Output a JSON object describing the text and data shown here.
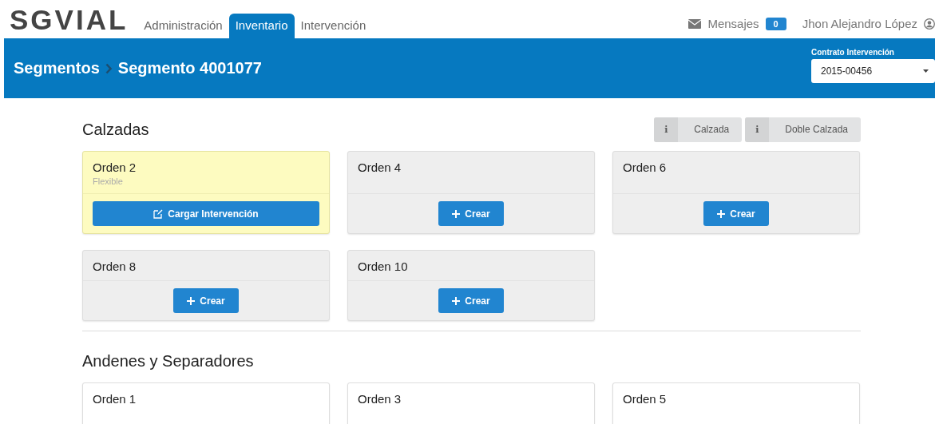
{
  "header": {
    "logo": "SGVIAL",
    "tabs": [
      {
        "label": "Administración",
        "selected": false
      },
      {
        "label": "Inventario",
        "selected": true
      },
      {
        "label": "Intervención",
        "selected": false
      }
    ],
    "messages": {
      "label": "Mensajes",
      "count": "0"
    },
    "user": "Jhon Alejandro López"
  },
  "title_bar": {
    "breadcrumb": [
      "Segmentos",
      "Segmento 4001077"
    ],
    "contract": {
      "label": "Contrato Intervención",
      "value": "2015-00456"
    }
  },
  "sections": [
    {
      "title": "Calzadas",
      "actions": [
        {
          "icon": "i",
          "label": "Calzada"
        },
        {
          "icon": "i",
          "label": "Doble Calzada"
        }
      ],
      "cards": [
        {
          "title": "Orden 2",
          "subtitle": "Flexible",
          "highlighted": true,
          "button": {
            "kind": "load",
            "label": "Cargar Intervención"
          }
        },
        {
          "title": "Orden 4",
          "highlighted": false,
          "button": {
            "kind": "create",
            "label": "Crear"
          }
        },
        {
          "title": "Orden 6",
          "highlighted": false,
          "button": {
            "kind": "create",
            "label": "Crear"
          }
        },
        {
          "title": "Orden 8",
          "highlighted": false,
          "button": {
            "kind": "create",
            "label": "Crear"
          }
        },
        {
          "title": "Orden 10",
          "highlighted": false,
          "button": {
            "kind": "create",
            "label": "Crear"
          }
        }
      ]
    },
    {
      "title": "Andenes y Separadores",
      "cards": [
        {
          "title": "Orden 1",
          "highlighted": false,
          "blank": true
        },
        {
          "title": "Orden 3",
          "highlighted": false,
          "blank": true
        },
        {
          "title": "Orden 5",
          "highlighted": false,
          "blank": true
        }
      ]
    }
  ]
}
